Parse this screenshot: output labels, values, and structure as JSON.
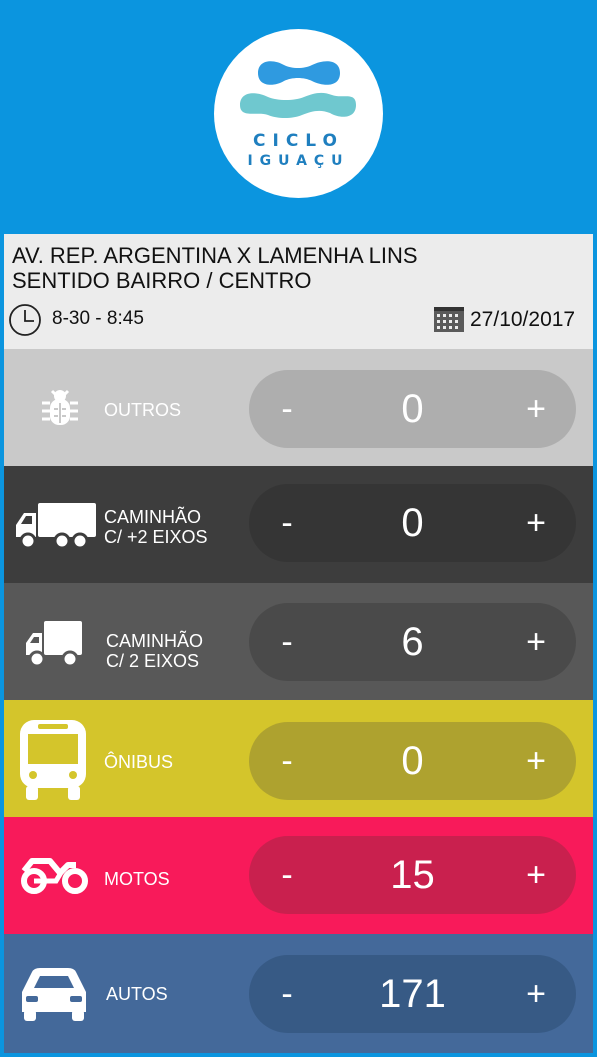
{
  "header": {
    "logo_line1": "CICLO",
    "logo_line2": "IGUAÇU"
  },
  "info": {
    "location_line1": "AV. REP. ARGENTINA X LAMENHA LINS",
    "location_line2": "SENTIDO BAIRRO / CENTRO",
    "time_range": "8-30 - 8:45",
    "date": "27/10/2017",
    "clock_icon": "clock-icon",
    "calendar_icon": "calendar-icon"
  },
  "counters": [
    {
      "label_line1": "OUTROS",
      "label_line2": "",
      "count": "0",
      "minus": "-",
      "plus": "+",
      "icon": "bug-icon",
      "bg": "#c9c9c9",
      "pill_bg": "#aeaeae"
    },
    {
      "label_line1": "CAMINHÃO",
      "label_line2": "C/ +2 EIXOS",
      "count": "0",
      "minus": "-",
      "plus": "+",
      "icon": "truck-icon",
      "bg": "#3d3d3d",
      "pill_bg": "#353535"
    },
    {
      "label_line1": "CAMINHÃO",
      "label_line2": "C/ 2 EIXOS",
      "count": "6",
      "minus": "-",
      "plus": "+",
      "icon": "small-truck-icon",
      "bg": "#585858",
      "pill_bg": "#4a4a4a"
    },
    {
      "label_line1": "ÔNIBUS",
      "label_line2": "",
      "count": "0",
      "minus": "-",
      "plus": "+",
      "icon": "bus-icon",
      "bg": "#d4c52b",
      "pill_bg": "#aea22f"
    },
    {
      "label_line1": "MOTOS",
      "label_line2": "",
      "count": "15",
      "minus": "-",
      "plus": "+",
      "icon": "motorcycle-icon",
      "bg": "#f81a5a",
      "pill_bg": "#c9204e"
    },
    {
      "label_line1": "AUTOS",
      "label_line2": "",
      "count": "171",
      "minus": "-",
      "plus": "+",
      "icon": "car-icon",
      "bg": "#44699a",
      "pill_bg": "#375a85"
    }
  ]
}
